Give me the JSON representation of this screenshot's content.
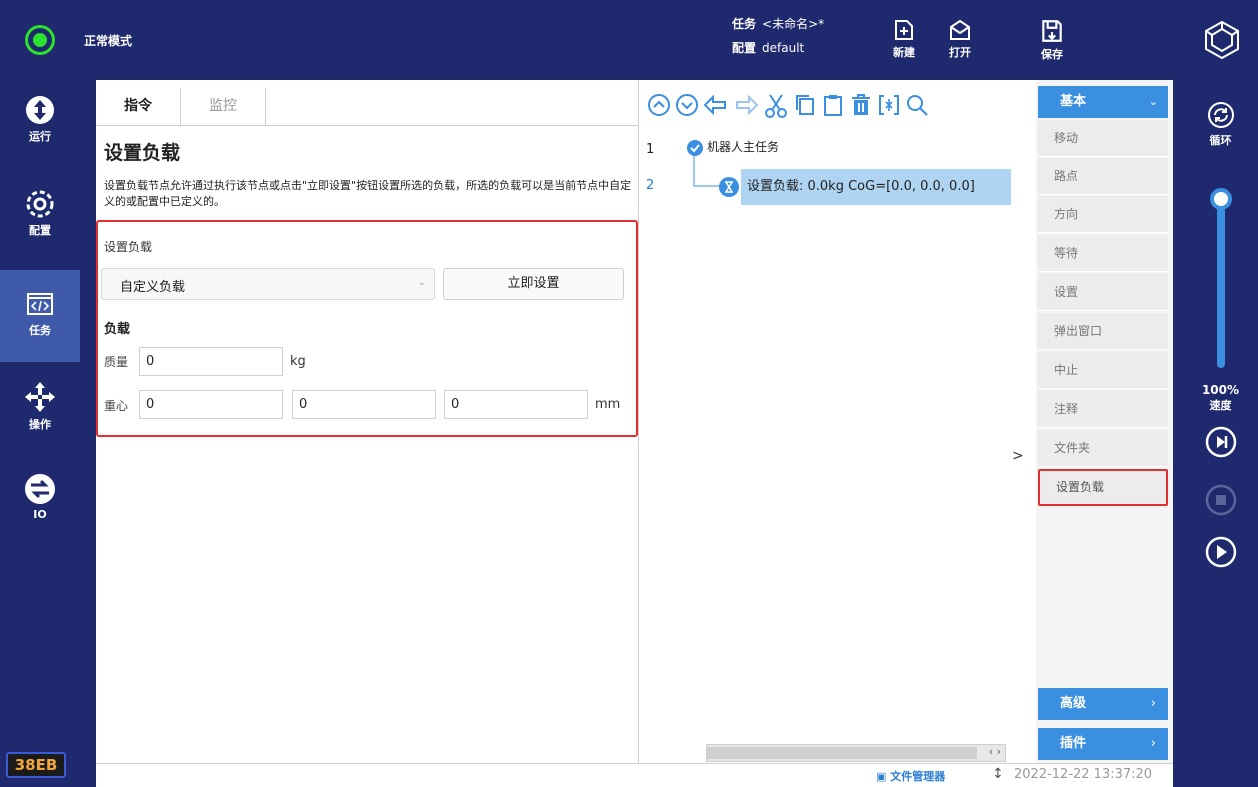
{
  "topbar": {
    "mode": "正常模式",
    "task_label": "任务",
    "task_value": "<未命名>*",
    "config_label": "配置",
    "config_value": "default",
    "new_label": "新建",
    "open_label": "打开",
    "save_label": "保存"
  },
  "nav": {
    "run": "运行",
    "config": "配置",
    "task": "任务",
    "operate": "操作",
    "io": "IO",
    "badge": "38EB"
  },
  "tabs": {
    "instructions": "指令",
    "monitor": "监控"
  },
  "panel": {
    "title": "设置负载",
    "description": "设置负载节点允许通过执行该节点或点击\"立即设置\"按钮设置所选的负载，所选的负载可以是当前节点中自定义的或配置中已定义的。",
    "set_load_label": "设置负载",
    "dropdown_value": "自定义负载",
    "set_now_button": "立即设置",
    "load_label": "负载",
    "mass_label": "质量",
    "mass_value": "0",
    "mass_unit": "kg",
    "cog_label": "重心",
    "cog_x": "0",
    "cog_y": "0",
    "cog_z": "0",
    "cog_unit": "mm"
  },
  "tree": {
    "line1": "1",
    "line2": "2",
    "root": "机器人主任务",
    "selected": "设置负载: 0.0kg CoG=[0.0, 0.0, 0.0]",
    "expander": ">"
  },
  "commands": {
    "basic": "基本",
    "items": [
      "移动",
      "路点",
      "方向",
      "等待",
      "设置",
      "弹出窗口",
      "中止",
      "注释",
      "文件夹",
      "设置负载"
    ],
    "advanced": "高级",
    "plugins": "插件"
  },
  "status": {
    "file_manager": "文件管理器",
    "datetime": "2022-12-22 13:37:20"
  },
  "speed": {
    "loop": "循环",
    "percent": "100%",
    "label": "速度",
    "level": 1.0
  },
  "colors": {
    "accent": "#3a8fe0",
    "nav_bg": "#1f2a6e",
    "highlight": "#e23030",
    "mode_ok": "#2ee02e"
  }
}
